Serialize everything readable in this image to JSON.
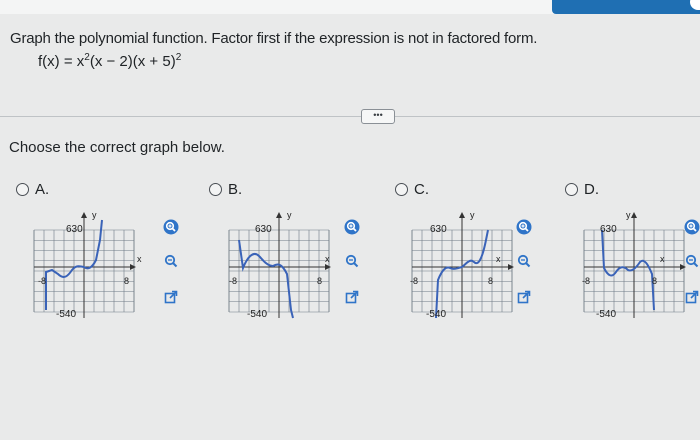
{
  "header": {
    "accent_color": "#1f6fb3"
  },
  "question": {
    "instruction": "Graph the polynomial function. Factor first if the expression is not in factored form.",
    "formula_prefix": "f(x) = x",
    "exp1": "2",
    "formula_mid": "(x − 2)(x + 5)",
    "exp2": "2"
  },
  "more_label": "•••",
  "prompt": "Choose the correct graph below.",
  "options": [
    {
      "label": "A.",
      "ymax": "630",
      "ymin": "-540",
      "xmin": "-8",
      "xmax": "8",
      "ylabel": "y",
      "xlabel": "x"
    },
    {
      "label": "B.",
      "ymax": "630",
      "ymin": "-540",
      "xmin": "-8",
      "xmax": "8",
      "ylabel": "y",
      "xlabel": "x"
    },
    {
      "label": "C.",
      "ymax": "630",
      "ymin": "-540",
      "xmin": "-8",
      "xmax": "8",
      "ylabel": "y",
      "xlabel": "x"
    },
    {
      "label": "D.",
      "ymax": "630",
      "ymin": "-540",
      "xmin": "-8",
      "xmax": "8",
      "ylabel": "y",
      "xlabel": "x"
    }
  ],
  "tool_icons": [
    "zoom-in-icon",
    "zoom-out-icon",
    "open-external-icon"
  ],
  "colors": {
    "curve": "#3a63b8",
    "grid": "#6f7a85",
    "tool_blue": "#2f74c8"
  }
}
